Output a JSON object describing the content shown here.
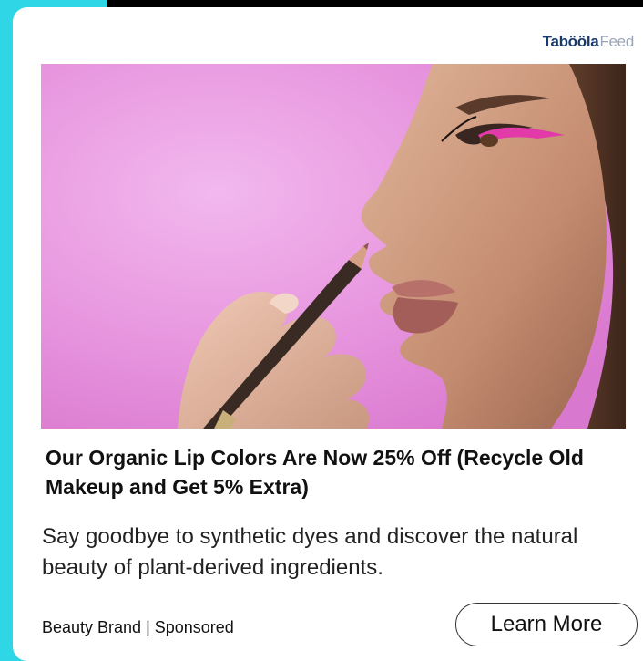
{
  "brand": {
    "logo_bold": "Tabööla",
    "logo_light": "Feed"
  },
  "ad": {
    "image_icon": "lip-liner-model-photo",
    "headline": "Our Organic Lip Colors Are Now 25% Off (Recycle Old Makeup and Get 5% Extra)",
    "description": "Say goodbye to synthetic dyes and discover the natural beauty of plant-derived ingredients.",
    "source": "Beauty Brand | Sponsored",
    "cta_label": "Learn More"
  },
  "colors": {
    "page_accent": "#2fd6e6",
    "logo_dark": "#1a3a6b",
    "logo_light": "#9aa6b8",
    "hero_background": "#e79be0"
  }
}
